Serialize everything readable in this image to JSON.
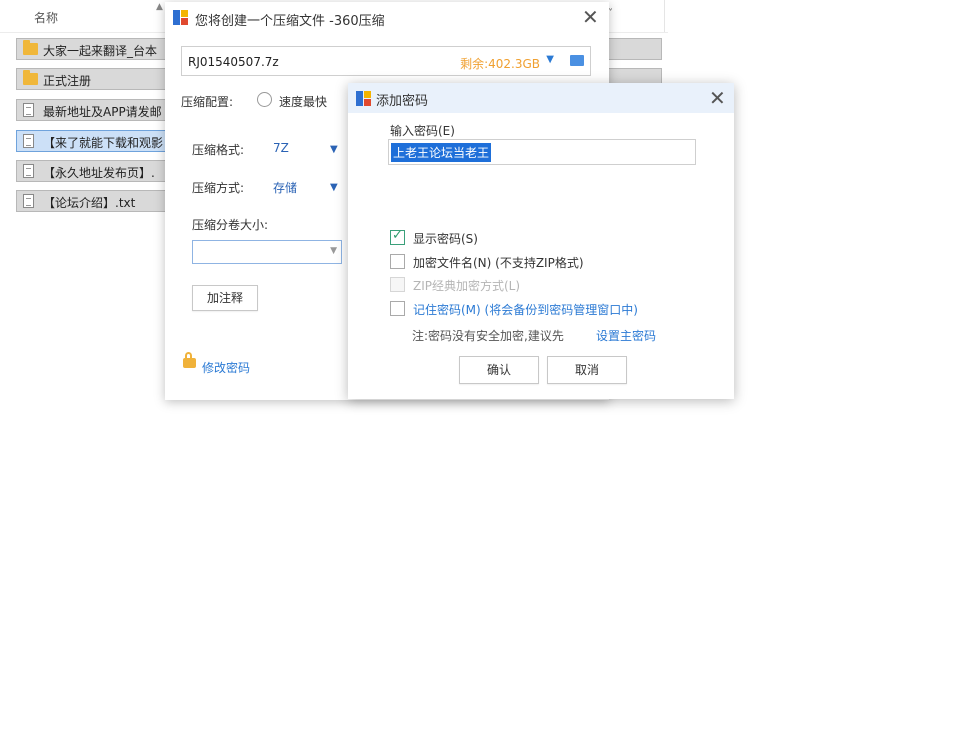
{
  "explorer": {
    "column_name": "名称",
    "files": [
      {
        "label": "大家一起来翻译_台本",
        "type": "folder",
        "selected": false
      },
      {
        "label": "正式注册",
        "type": "folder",
        "selected": false
      },
      {
        "label": "最新地址及APP请发邮",
        "type": "doc",
        "selected": false
      },
      {
        "label": "【来了就能下载和观影",
        "type": "doc",
        "selected": true
      },
      {
        "label": "【永久地址发布页】.",
        "type": "doc",
        "selected": false
      },
      {
        "label": "【论坛介绍】.txt",
        "type": "doc",
        "selected": false
      }
    ]
  },
  "main_dialog": {
    "title": "您将创建一个压缩文件 -360压缩",
    "filename": "RJ01540507.7z",
    "free_space": "剩余:402.3GB",
    "config_label": "压缩配置:",
    "speed_option": "速度最快",
    "format_label": "压缩格式:",
    "format_value": "7Z",
    "method_label": "压缩方式:",
    "method_value": "存储",
    "split_label": "压缩分卷大小:",
    "split_value": "",
    "comment_button": "加注释",
    "change_password_link": "修改密码"
  },
  "password_dialog": {
    "title": "添加密码",
    "input_label": "输入密码(E)",
    "password_value": "上老王论坛当老王",
    "show_password": {
      "label": "显示密码(S)",
      "checked": true
    },
    "encrypt_names": {
      "label": "加密文件名(N) (不支持ZIP格式)",
      "checked": false
    },
    "zip_classic": {
      "label": "ZIP经典加密方式(L)",
      "checked": false,
      "disabled": true
    },
    "remember": {
      "label": "记住密码(M) (将会备份到密码管理窗口中)",
      "checked": false
    },
    "note_text": "注:密码没有安全加密,建议先",
    "note_link": "设置主密码",
    "ok_button": "确认",
    "cancel_button": "取消"
  }
}
